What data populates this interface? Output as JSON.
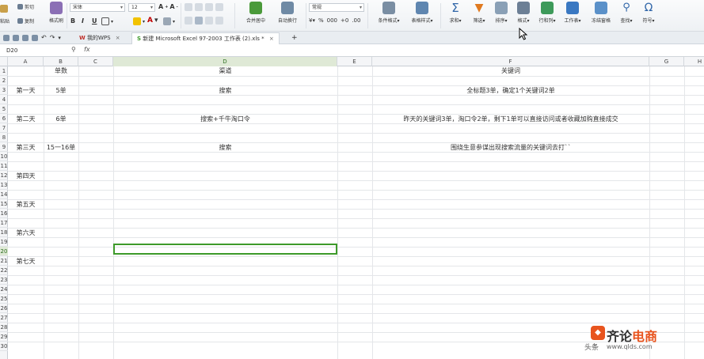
{
  "ribbon": {
    "cut": "剪切",
    "copy": "复制",
    "paste": "粘贴",
    "format_painter": "格式刷",
    "font_name": "宋体",
    "font_size": "12",
    "bold": "B",
    "italic": "I",
    "underline": "U",
    "merge_center": "合并居中",
    "wrap_text": "自动换行",
    "number_format": "常规",
    "conditional_format": "条件格式",
    "table_style": "表格样式",
    "sum": "求和",
    "filter": "筛选",
    "sort": "排序",
    "format": "格式",
    "row_col": "行和列",
    "worksheet": "工作表",
    "freeze": "冻结窗格",
    "find": "查找",
    "symbol": "符号"
  },
  "tabs": {
    "wps": "我的WPS",
    "file": "新建 Microsoft Excel 97-2003 工作表 (2).xls *",
    "add": "+"
  },
  "formula_bar": {
    "cell_ref": "D20",
    "fx": "fx",
    "value": ""
  },
  "columns": [
    "A",
    "B",
    "C",
    "D",
    "E",
    "F",
    "G",
    "H"
  ],
  "rows": [
    "1",
    "2",
    "3",
    "4",
    "5",
    "6",
    "7",
    "8",
    "9",
    "10",
    "11",
    "12",
    "13",
    "14",
    "15",
    "16",
    "17",
    "18",
    "19",
    "20",
    "21",
    "22",
    "23",
    "24",
    "25",
    "26",
    "27",
    "28",
    "29",
    "30"
  ],
  "cells": {
    "b1": "单数",
    "d1": "渠道",
    "f1": "关键词",
    "a3": "第一天",
    "b3": "5单",
    "d3": "搜索",
    "f3": "全标题3单，确定1个关键词2单",
    "a6": "第二天",
    "b6": "6单",
    "d6": "搜索+千牛淘口令",
    "f6": "昨天的关键词3单，淘口令2单，剩下1单可以直接访问或者收藏加购直接成交",
    "a9": "第三天",
    "b9": "15一16单",
    "d9": "搜索",
    "f9": "围绕生意参谋出现搜索流量的关键词去打``",
    "a12": "第四天",
    "a15": "第五天",
    "a18": "第六天",
    "a21": "第七天"
  },
  "watermark": {
    "brand_1": "齐论",
    "brand_2": "电商",
    "source": "头条",
    "sub": "www.qlds.com"
  }
}
